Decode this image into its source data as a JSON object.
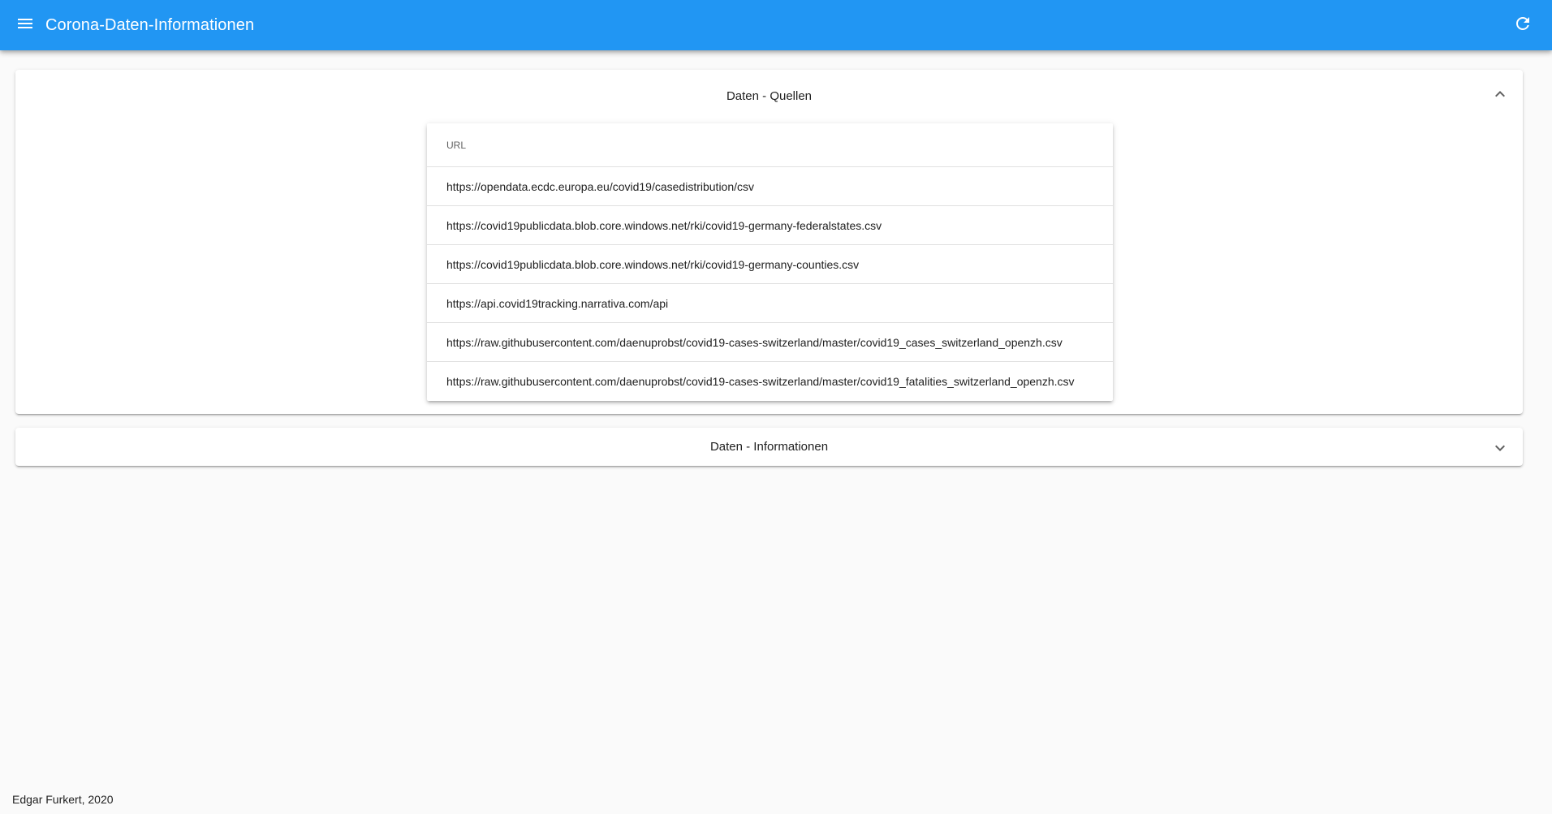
{
  "app": {
    "title": "Corona-Daten-Informationen",
    "menu_icon": "menu-icon",
    "refresh_icon": "refresh-icon",
    "bar_color": "#2196f3"
  },
  "sources_panel": {
    "title": "Daten - Quellen",
    "expanded": true,
    "table": {
      "column_header": "URL",
      "rows": [
        "https://opendata.ecdc.europa.eu/covid19/casedistribution/csv",
        "https://covid19publicdata.blob.core.windows.net/rki/covid19-germany-federalstates.csv",
        "https://covid19publicdata.blob.core.windows.net/rki/covid19-germany-counties.csv",
        "https://api.covid19tracking.narrativa.com/api",
        "https://raw.githubusercontent.com/daenuprobst/covid19-cases-switzerland/master/covid19_cases_switzerland_openzh.csv",
        "https://raw.githubusercontent.com/daenuprobst/covid19-cases-switzerland/master/covid19_fatalities_switzerland_openzh.csv"
      ]
    }
  },
  "info_panel": {
    "title": "Daten - Informationen",
    "expanded": false
  },
  "footer": {
    "text": "Edgar Furkert, 2020"
  }
}
